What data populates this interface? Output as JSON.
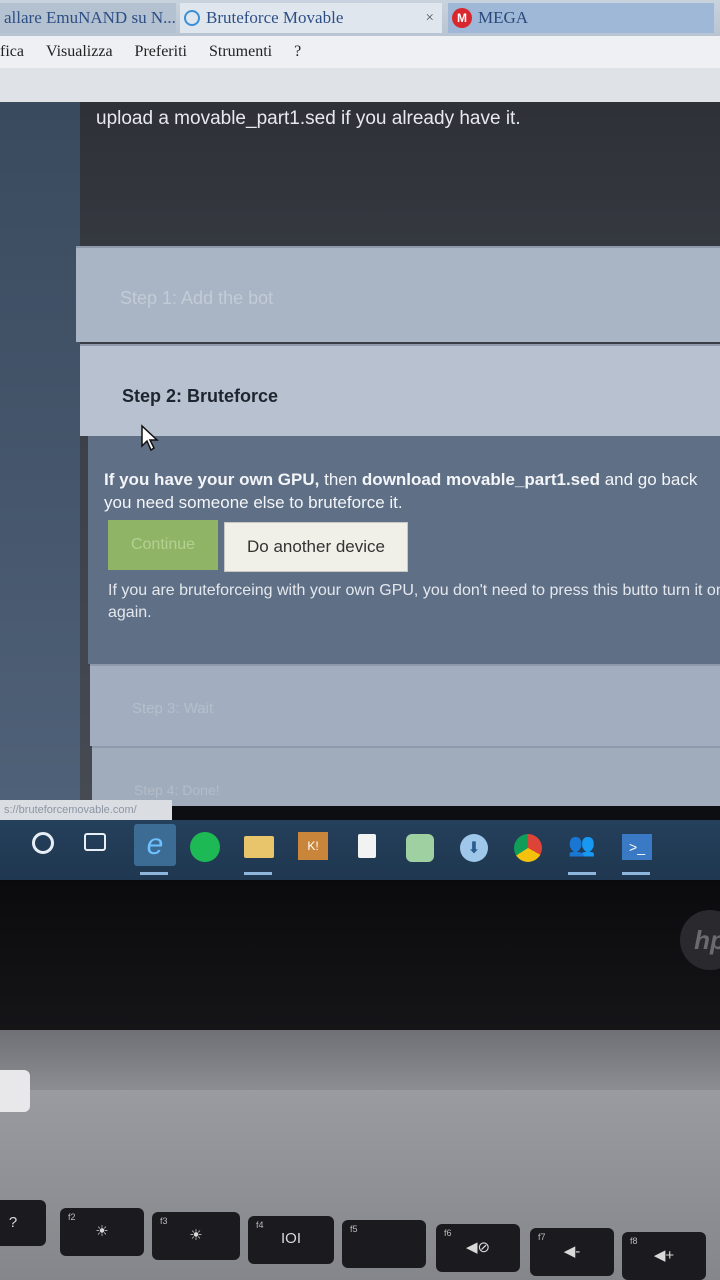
{
  "browser": {
    "tabs": [
      {
        "label": "allare EmuNAND su N..."
      },
      {
        "label": "Bruteforce Movable",
        "close": "×"
      },
      {
        "label": "MEGA",
        "badge": "M"
      }
    ],
    "menu": [
      "fica",
      "Visualizza",
      "Preferiti",
      "Strumenti",
      "?"
    ]
  },
  "page": {
    "intro": "upload a movable_part1.sed if you already have it.",
    "steps": [
      {
        "label": "Step 1: Add the bot"
      },
      {
        "label": "Step 2: Bruteforce"
      },
      {
        "label": "Step 3: Wait"
      },
      {
        "label": "Step 4: Done!"
      }
    ],
    "step2_panel": {
      "text_bold_1": "If you have your own GPU,",
      "text_1": " then ",
      "text_bold_2": "download movable_part1.sed",
      "text_2": " and go back",
      "text_3": "you need someone else to bruteforce it.",
      "continue_label": "Continue",
      "other_label": "Do another device",
      "note": "If you are bruteforceing with your own GPU, you don't need to press this butto turn it on again."
    },
    "status_url": "s://bruteforcemovable.com/"
  },
  "taskbar": {
    "edge_glyph": "e",
    "app1_glyph": "K!",
    "download_glyph": "⬇",
    "people_glyph": "👥",
    "shell_glyph": ">_"
  },
  "laptop": {
    "logo": "hp",
    "keys": [
      {
        "sub": "",
        "main": "?"
      },
      {
        "sub": "f2",
        "main": "☀"
      },
      {
        "sub": "f3",
        "main": "☀"
      },
      {
        "sub": "f4",
        "main": "IOI"
      },
      {
        "sub": "f5",
        "main": ""
      },
      {
        "sub": "f6",
        "main": "◀⊘"
      },
      {
        "sub": "f7",
        "main": "◀-"
      },
      {
        "sub": "f8",
        "main": "◀+"
      }
    ]
  },
  "colors": {
    "continue_bg": "#8fb466",
    "panel_bg": "#5f6f86",
    "taskbar_bg": "#25405c"
  }
}
